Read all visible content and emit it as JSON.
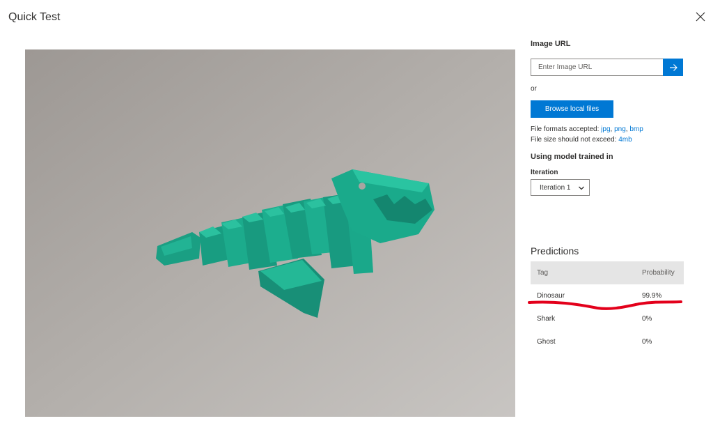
{
  "dialog": {
    "title": "Quick Test"
  },
  "image_url": {
    "label": "Image URL",
    "placeholder": "Enter Image URL"
  },
  "or_text": "or",
  "browse_button": "Browse local files",
  "file_formats": {
    "prefix": "File formats accepted: ",
    "jpg": "jpg",
    "png": "png",
    "bmp": "bmp",
    "sep": ", "
  },
  "file_size": {
    "prefix": "File size should not exceed: ",
    "value": "4mb"
  },
  "model": {
    "label": "Using model trained in",
    "iteration_label": "Iteration",
    "selected": "Iteration 1"
  },
  "predictions": {
    "title": "Predictions",
    "headers": {
      "tag": "Tag",
      "probability": "Probability"
    },
    "rows": [
      {
        "tag": "Dinosaur",
        "probability": "99.9%"
      },
      {
        "tag": "Shark",
        "probability": "0%"
      },
      {
        "tag": "Ghost",
        "probability": "0%"
      }
    ]
  },
  "colors": {
    "accent": "#0078d4",
    "annotation": "#e3001b",
    "model_green": "#1aa88a"
  },
  "icons": {
    "close": "close-icon",
    "submit": "arrow-right-icon",
    "dropdown": "chevron-down-icon"
  }
}
